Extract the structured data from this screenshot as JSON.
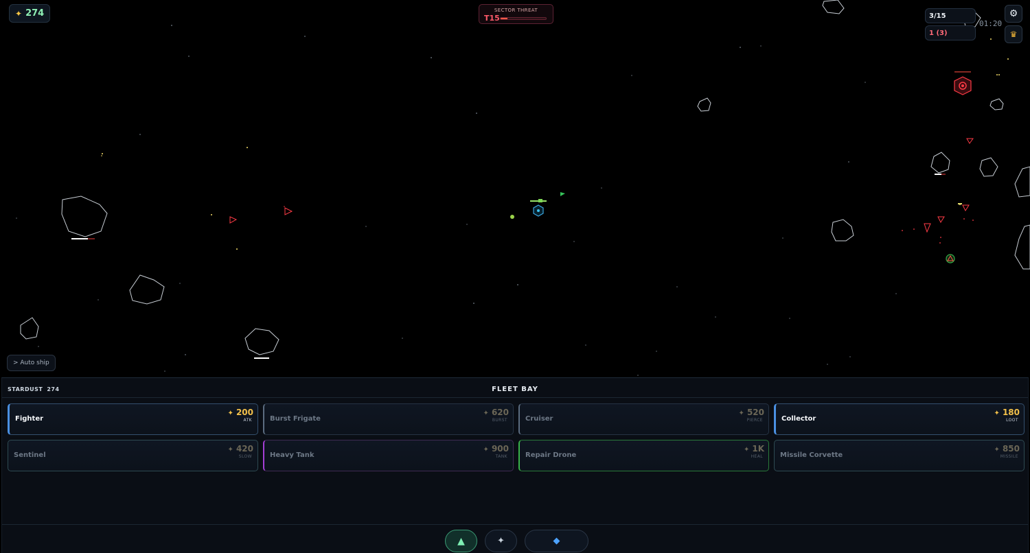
{
  "hud": {
    "stardust": "274",
    "threat_label": "SECTOR THREAT",
    "threat_tier": "T15",
    "threat_fill": 0.15,
    "wave_count": "3/15",
    "lives": "1 (3)",
    "timer": "01:20",
    "auto_ship_label": "> Auto ship"
  },
  "fleet_bay": {
    "stardust_label": "STARDUST",
    "stardust_value": "274",
    "title": "FLEET BAY",
    "ships": [
      {
        "name": "Fighter",
        "cost": "200",
        "role": "ATK"
      },
      {
        "name": "Burst Frigate",
        "cost": "620",
        "role": "BURST"
      },
      {
        "name": "Cruiser",
        "cost": "520",
        "role": "PIERCE"
      },
      {
        "name": "Collector",
        "cost": "180",
        "role": "LOOT"
      },
      {
        "name": "Sentinel",
        "cost": "420",
        "role": "SLOW"
      },
      {
        "name": "Heavy Tank",
        "cost": "900",
        "role": "TANK"
      },
      {
        "name": "Repair Drone",
        "cost": "1K",
        "role": "HEAL"
      },
      {
        "name": "Missile Corvette",
        "cost": "850",
        "role": "MISSILE"
      }
    ]
  },
  "icons": {
    "stardust": "✦",
    "settings": "⚙",
    "leaderboard": "♛",
    "tab_ships": "▲",
    "tab_upgrades": "✦",
    "tab_crystals": "◆"
  },
  "colors": {
    "stardust_accent": "#f6c544",
    "threat": "#ff5a6a",
    "affordable_border": "#4a90e2",
    "active_tab": "#7ef0b4"
  }
}
